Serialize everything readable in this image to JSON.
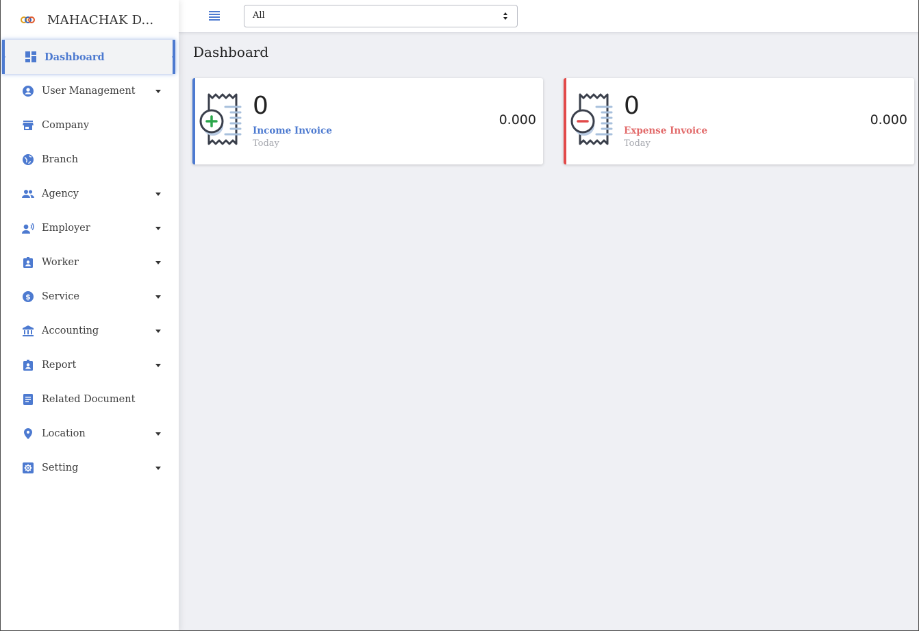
{
  "brand": {
    "title": "MAHACHAK D..."
  },
  "sidebar": {
    "items": [
      {
        "label": "Dashboard",
        "icon": "dashboard-icon",
        "active": true,
        "has_caret": false
      },
      {
        "label": "User Management",
        "icon": "account-circle-icon",
        "has_caret": true
      },
      {
        "label": "Company",
        "icon": "store-icon",
        "has_caret": false
      },
      {
        "label": "Branch",
        "icon": "globe-icon",
        "has_caret": false
      },
      {
        "label": "Agency",
        "icon": "people-icon",
        "has_caret": true
      },
      {
        "label": "Employer",
        "icon": "record-voice-icon",
        "has_caret": true
      },
      {
        "label": "Worker",
        "icon": "badge-icon",
        "has_caret": true
      },
      {
        "label": "Service",
        "icon": "dollar-circle-icon",
        "has_caret": true
      },
      {
        "label": "Accounting",
        "icon": "bank-icon",
        "has_caret": true
      },
      {
        "label": "Report",
        "icon": "badge-icon",
        "has_caret": true
      },
      {
        "label": "Related Document",
        "icon": "document-icon",
        "has_caret": false
      },
      {
        "label": "Location",
        "icon": "location-pin-icon",
        "has_caret": true
      },
      {
        "label": "Setting",
        "icon": "settings-icon",
        "has_caret": true
      }
    ]
  },
  "topbar": {
    "filter": {
      "selected": "All"
    }
  },
  "main": {
    "title": "Dashboard",
    "cards": [
      {
        "count": "0",
        "label": "Income Invoice",
        "period": "Today",
        "amount": "0.000"
      },
      {
        "count": "0",
        "label": "Expense Invoice",
        "period": "Today",
        "amount": "0.000"
      }
    ]
  },
  "colors": {
    "accent": "#4d7ad0",
    "danger": "#e24a4a",
    "background": "#eff0f4"
  }
}
